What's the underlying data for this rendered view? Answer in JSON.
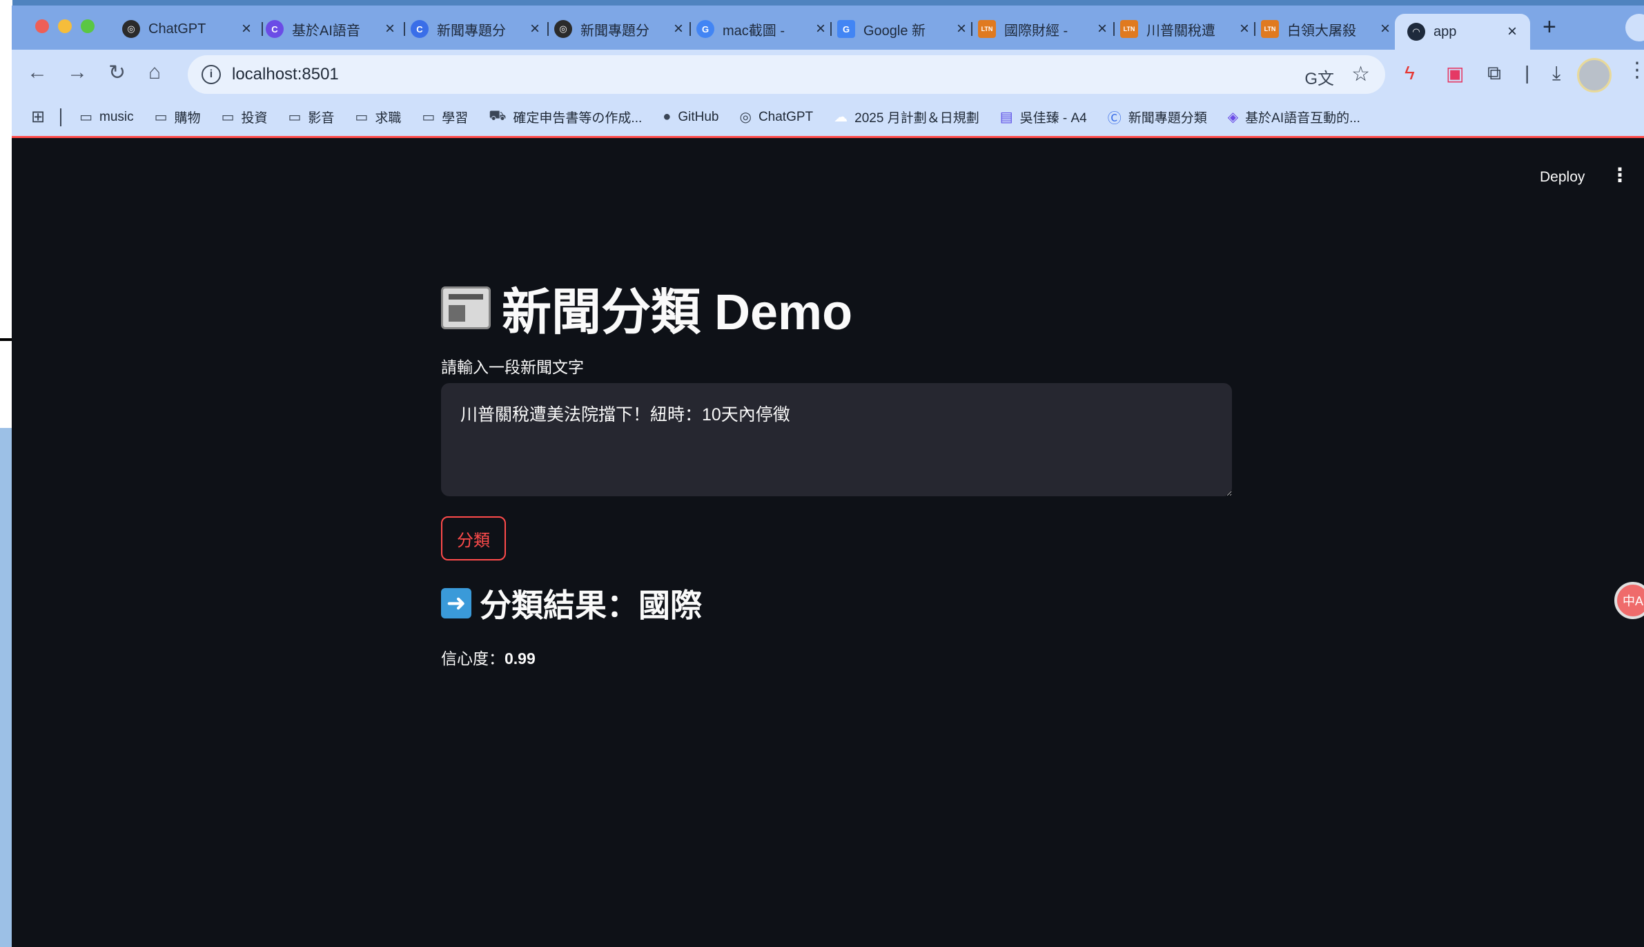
{
  "browser": {
    "tabs": [
      {
        "label": "ChatGPT",
        "icon": "openai-icon",
        "icon_color": "#2b2b2b"
      },
      {
        "label": "基於AI語音",
        "icon": "copilot-icon",
        "icon_color": "#6b4ce6"
      },
      {
        "label": "新聞專題分",
        "icon": "c-logo-icon",
        "icon_color": "#3a6ee8"
      },
      {
        "label": "新聞專題分",
        "icon": "openai-icon",
        "icon_color": "#2b2b2b"
      },
      {
        "label": "mac截圖 -",
        "icon": "google-icon",
        "icon_color": "#4285f4"
      },
      {
        "label": "Google 新",
        "icon": "google-translate-icon",
        "icon_color": "#4285f4"
      },
      {
        "label": "國際財經 -",
        "icon": "ltn-icon",
        "icon_color": "#e07a1f"
      },
      {
        "label": "川普關稅遭",
        "icon": "ltn-icon",
        "icon_color": "#e07a1f"
      },
      {
        "label": "白領大屠殺",
        "icon": "ltn-icon",
        "icon_color": "#e07a1f"
      },
      {
        "label": "app",
        "icon": "streamlit-icon",
        "icon_color": "#1e2a3c",
        "active": true
      }
    ],
    "url": "localhost:8501",
    "bookmarks": [
      {
        "label": "music",
        "icon": "folder-icon"
      },
      {
        "label": "購物",
        "icon": "folder-icon"
      },
      {
        "label": "投資",
        "icon": "folder-icon"
      },
      {
        "label": "影音",
        "icon": "folder-icon"
      },
      {
        "label": "求職",
        "icon": "folder-icon"
      },
      {
        "label": "學習",
        "icon": "folder-icon"
      },
      {
        "label": "確定申告書等の作成...",
        "icon": "tax-icon"
      },
      {
        "label": "GitHub",
        "icon": "github-icon"
      },
      {
        "label": "ChatGPT",
        "icon": "openai-icon"
      },
      {
        "label": "2025 月計劃＆日規劃",
        "icon": "cloud-icon"
      },
      {
        "label": "吳佳臻 - A4",
        "icon": "doc-icon"
      },
      {
        "label": "新聞專題分類",
        "icon": "c-logo-icon"
      },
      {
        "label": "基於AI語音互動的...",
        "icon": "copilot-icon"
      }
    ]
  },
  "app": {
    "deploy_label": "Deploy",
    "title": "新聞分類 Demo",
    "input_label": "請輸入一段新聞文字",
    "input_value": "川普關稅遭美法院擋下！紐時：10天內停徵",
    "button_label": "分類",
    "result_heading": "分類結果：國際",
    "confidence_label": "信心度：",
    "confidence_value": "0.99",
    "accent_color": "#ff4b4b"
  }
}
